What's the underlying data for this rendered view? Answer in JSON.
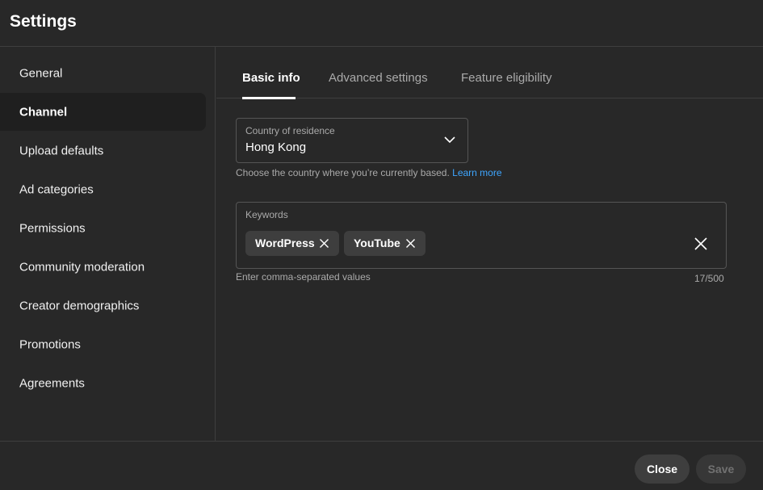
{
  "header": {
    "title": "Settings"
  },
  "sidebar": {
    "items": [
      {
        "label": "General"
      },
      {
        "label": "Channel"
      },
      {
        "label": "Upload defaults"
      },
      {
        "label": "Ad categories"
      },
      {
        "label": "Permissions"
      },
      {
        "label": "Community moderation"
      },
      {
        "label": "Creator demographics"
      },
      {
        "label": "Promotions"
      },
      {
        "label": "Agreements"
      }
    ],
    "active": "Channel"
  },
  "tabs": [
    {
      "label": "Basic info"
    },
    {
      "label": "Advanced settings"
    },
    {
      "label": "Feature eligibility"
    }
  ],
  "active_tab": "Basic info",
  "country": {
    "label": "Country of residence",
    "value": "Hong Kong",
    "help": "Choose the country where you’re currently based.",
    "learn_more": "Learn more"
  },
  "keywords": {
    "label": "Keywords",
    "chips": [
      {
        "label": "WordPress"
      },
      {
        "label": "YouTube"
      }
    ],
    "help": "Enter comma-separated values",
    "counter": "17/500"
  },
  "footer": {
    "close_label": "Close",
    "save_label": "Save"
  },
  "colors": {
    "background": "#282828",
    "accent_link": "#3ea6ff",
    "active_item_bg": "#1f1f1f",
    "chip_bg": "#3e3e3e"
  },
  "icons": {
    "country_dropdown": "chevron-down-icon",
    "chip_remove": "close-icon",
    "clear_keywords": "close-icon"
  }
}
